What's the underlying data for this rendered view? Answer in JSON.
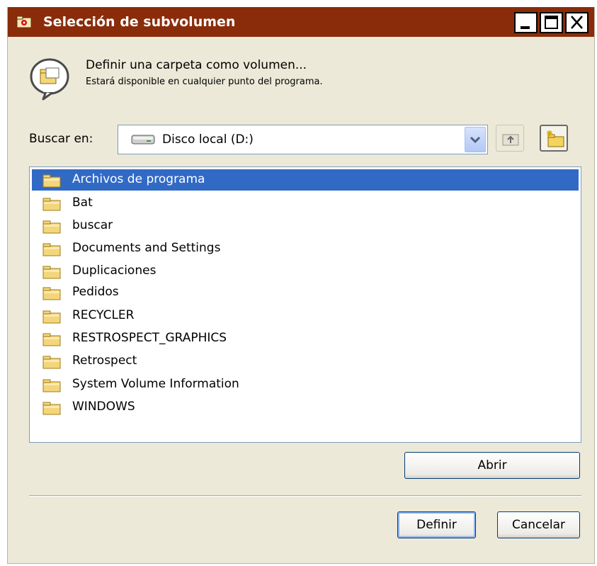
{
  "window": {
    "title": "Selección de subvolumen",
    "controls": {
      "minimize": "minimize-icon",
      "maximize": "maximize-icon",
      "close": "close-icon"
    }
  },
  "header": {
    "line1": "Definir una carpeta como volumen...",
    "line2": "Estará disponible en cualquier punto del programa."
  },
  "look_in": {
    "label": "Buscar en:",
    "value": "Disco local (D:)"
  },
  "folders": [
    {
      "name": "Archivos de programa",
      "selected": true
    },
    {
      "name": "Bat"
    },
    {
      "name": "buscar"
    },
    {
      "name": "Documents and Settings"
    },
    {
      "name": "Duplicaciones"
    },
    {
      "name": "Pedidos"
    },
    {
      "name": "RECYCLER"
    },
    {
      "name": "RESTROSPECT_GRAPHICS"
    },
    {
      "name": "Retrospect"
    },
    {
      "name": "System Volume Information"
    },
    {
      "name": "WINDOWS"
    }
  ],
  "buttons": {
    "open": "Abrir",
    "define": "Definir",
    "cancel": "Cancelar"
  },
  "colors": {
    "titlebar": "#8a2c0a",
    "dialog_bg": "#ece9d8",
    "selection": "#316ac5"
  }
}
